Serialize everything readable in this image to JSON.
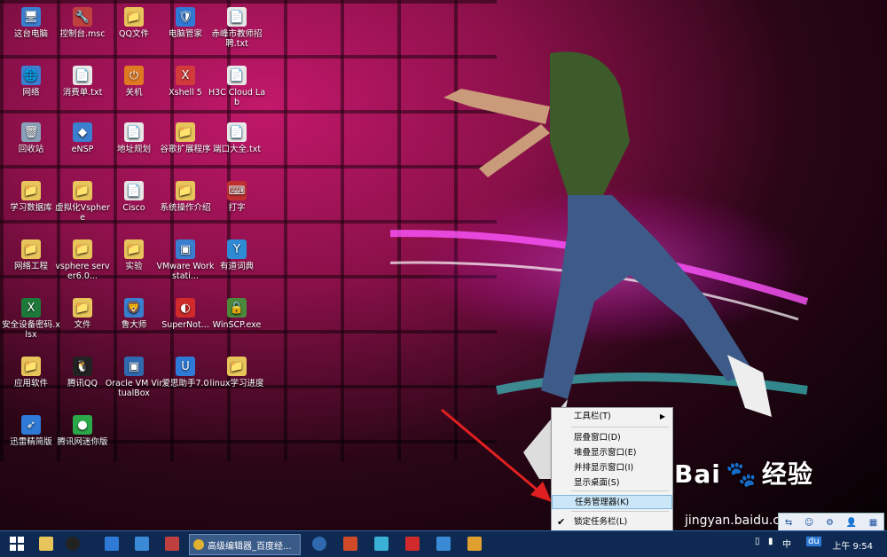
{
  "desktop": {
    "icons": [
      {
        "label": "这台电脑",
        "glyph": "🖥",
        "color": "#3b7fd0"
      },
      {
        "label": "控制台.msc",
        "glyph": "🔧",
        "color": "#c04040"
      },
      {
        "label": "QQ文件",
        "glyph": "📁",
        "color": "#e8c55a"
      },
      {
        "label": "电脑管家",
        "glyph": "🛡",
        "color": "#2f7ad6"
      },
      {
        "label": "赤峰市教师招聘.txt",
        "glyph": "📄",
        "color": "#e8e8e8"
      },
      {
        "label": "网络",
        "glyph": "🌐",
        "color": "#3b7fd0"
      },
      {
        "label": "消费单.txt",
        "glyph": "📄",
        "color": "#e8e8e8"
      },
      {
        "label": "关机",
        "glyph": "⏻",
        "color": "#e07a22"
      },
      {
        "label": "Xshell 5",
        "glyph": "X",
        "color": "#d23b3b"
      },
      {
        "label": "H3C Cloud Lab",
        "glyph": "📄",
        "color": "#e8e8e8"
      },
      {
        "label": "回收站",
        "glyph": "🗑",
        "color": "#8aa0b8"
      },
      {
        "label": "eNSP",
        "glyph": "◆",
        "color": "#3b7fd0"
      },
      {
        "label": "地址规划",
        "glyph": "📄",
        "color": "#e8e8e8"
      },
      {
        "label": "谷歌扩展程序",
        "glyph": "📁",
        "color": "#e8c55a"
      },
      {
        "label": "端口大全.txt",
        "glyph": "📄",
        "color": "#e8e8e8"
      },
      {
        "label": "学习数据库",
        "glyph": "📁",
        "color": "#e8c55a"
      },
      {
        "label": "虚拟化Vsphere",
        "glyph": "📁",
        "color": "#e8c55a"
      },
      {
        "label": "Cisco",
        "glyph": "📄",
        "color": "#e8e8e8"
      },
      {
        "label": "系统操作介绍",
        "glyph": "📁",
        "color": "#e8c55a"
      },
      {
        "label": "打字",
        "glyph": "⌨",
        "color": "#c03030"
      },
      {
        "label": "网络工程",
        "glyph": "📁",
        "color": "#e8c55a"
      },
      {
        "label": "vsphere server6.0...",
        "glyph": "📁",
        "color": "#e8c55a"
      },
      {
        "label": "实验",
        "glyph": "📁",
        "color": "#e8c55a"
      },
      {
        "label": "VMware Workstati...",
        "glyph": "▣",
        "color": "#3b7fd0"
      },
      {
        "label": "有道词典",
        "glyph": "Y",
        "color": "#2f8ad6"
      },
      {
        "label": "安全设备密码.xlsx",
        "glyph": "X",
        "color": "#1d7a3a"
      },
      {
        "label": "文件",
        "glyph": "📁",
        "color": "#e8c55a"
      },
      {
        "label": "鲁大师",
        "glyph": "🦁",
        "color": "#3b7fd0"
      },
      {
        "label": "SuperNot...",
        "glyph": "◐",
        "color": "#d02a2a"
      },
      {
        "label": "WinSCP.exe",
        "glyph": "🔒",
        "color": "#4a8a3a"
      },
      {
        "label": "应用软件",
        "glyph": "📁",
        "color": "#e8c55a"
      },
      {
        "label": "腾讯QQ",
        "glyph": "🐧",
        "color": "#222"
      },
      {
        "label": "Oracle VM VirtualBox",
        "glyph": "▣",
        "color": "#2f6ab0"
      },
      {
        "label": "爱思助手7.0",
        "glyph": "U",
        "color": "#2f7ad6"
      },
      {
        "label": "linux学习进度",
        "glyph": "📁",
        "color": "#e8c55a"
      },
      {
        "label": "迅雷精简版",
        "glyph": "➶",
        "color": "#2f7ad6"
      },
      {
        "label": "腾讯网迷你版",
        "glyph": "●",
        "color": "#2aa84a"
      }
    ]
  },
  "context_menu": {
    "items": [
      {
        "label": "工具栏(T)",
        "submenu": true
      },
      {
        "label": "层叠窗口(D)"
      },
      {
        "label": "堆叠显示窗口(E)"
      },
      {
        "label": "并排显示窗口(I)"
      },
      {
        "label": "显示桌面(S)"
      },
      {
        "label": "任务管理器(K)",
        "highlighted": true
      },
      {
        "label": "锁定任务栏(L)",
        "checked": true
      },
      {
        "label": "属性(R)"
      }
    ]
  },
  "taskbar": {
    "active_task_label": "高级编辑器_百度经...",
    "clock": "上午 9:54",
    "ime_label": "中",
    "ime_du": "du"
  },
  "watermark": {
    "brand": "Bai",
    "brand_cn": "经验",
    "url": "jingyan.baidu.com"
  },
  "colors": {
    "taskbar": "#0f2a52",
    "menu_highlight": "#cbe6f7",
    "arrow": "#e02020"
  }
}
